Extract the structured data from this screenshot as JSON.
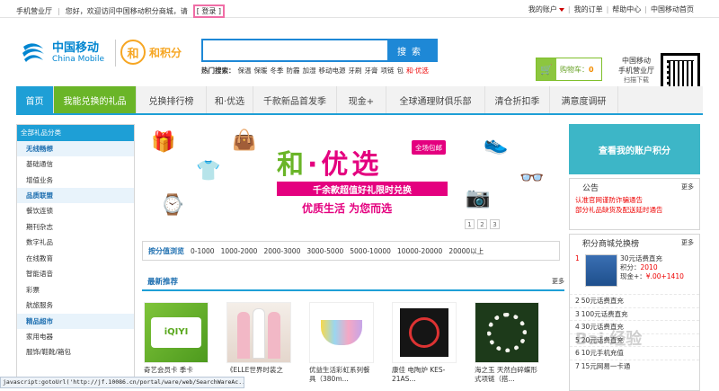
{
  "topbar": {
    "hall": "手机营业厅",
    "welcome": "您好，欢迎访问中国移动积分商城，请",
    "login": "登录",
    "account": "我的账户",
    "orders": "我的订单",
    "help": "帮助中心",
    "cmhome": "中国移动首页"
  },
  "logo": {
    "cn": "中国移动",
    "en": "China Mobile",
    "hjf": "和积分"
  },
  "search": {
    "button": "搜索",
    "hot_label": "热门搜索：",
    "hot": [
      "保温",
      "保暖",
      "冬季",
      "防霾",
      "加湿",
      "移动电源",
      "牙刷",
      "牙膏",
      "项链",
      "包"
    ],
    "hot_highlight": "和·优选"
  },
  "cart": {
    "label": "购物车：",
    "count": "0"
  },
  "app": {
    "line1": "中国移动",
    "line2": "手机营业厅",
    "line3": "扫描下载"
  },
  "nav": [
    "首页",
    "我能兑换的礼品",
    "兑换排行榜",
    "和·优选",
    "千款新品首发季",
    "现金+",
    "全球通理财俱乐部",
    "清仓折扣季",
    "满意度调研"
  ],
  "sidebar": {
    "head": "全部礼品分类",
    "groups": [
      {
        "title": "无线畅想",
        "items": [
          "基础通信",
          "增值业务"
        ]
      },
      {
        "title": "品质联盟",
        "items": [
          "餐饮连锁",
          "期刊杂志",
          "数字礼品",
          "在线教育",
          "智能语音",
          "彩票",
          "航旅服务"
        ]
      },
      {
        "title": "精品超市",
        "items": [
          "家用电器",
          "服饰/鞋靴/箱包"
        ]
      }
    ]
  },
  "banner": {
    "title_a": "和",
    "title_dot": "·",
    "title_b": "优选",
    "tag": "全场包邮",
    "ribbon": "千余款超值好礼限时兑换",
    "sub": "优质生活 为您而选",
    "pages": [
      "1",
      "2",
      "3"
    ]
  },
  "filter": {
    "label": "按分值浏览",
    "ranges": [
      "0-1000",
      "1000-2000",
      "2000-3000",
      "3000-5000",
      "5000-10000",
      "10000-20000",
      "20000以上"
    ]
  },
  "recommend": {
    "title": "最新推荐",
    "more": "更多"
  },
  "products": [
    {
      "name": "奇艺会员卡 季卡"
    },
    {
      "name": "《ELLE世界时装之"
    },
    {
      "name": "优益生活彩虹系列餐具（380m..."
    },
    {
      "name": "康佳 电陶炉 KES-21AS..."
    },
    {
      "name": "海之玉 天然白碎蝶形式项链（搭..."
    }
  ],
  "right": {
    "account_btn": "查看我的账户积分",
    "notice_title": "公告",
    "notice_more": "更多",
    "notices": [
      "认准官网谨防诈骗通告",
      "部分礼品缺货及配送延时通告"
    ],
    "rank_title": "积分商城兑换榜",
    "rank_more": "更多",
    "rank_first": {
      "no": "1",
      "name": "30元话费直充",
      "points_label": "积分：",
      "points": "2010",
      "cash_label": "现金+：",
      "cash": "¥.00+1410"
    },
    "rank_rows": [
      {
        "no": "2",
        "name": "50元话费直充"
      },
      {
        "no": "3",
        "name": "100元话费直充"
      },
      {
        "no": "4",
        "name": "30元话费直充"
      },
      {
        "no": "5",
        "name": "20元话费直充"
      },
      {
        "no": "6",
        "name": "10元手机充值"
      },
      {
        "no": "7",
        "name": "15元网易一卡通"
      }
    ]
  },
  "statusbar": "javascript:gotoUrl('http://jf.10086.cn/portal/ware/web/SearchWareAc...",
  "watermark": "Bai 经验"
}
